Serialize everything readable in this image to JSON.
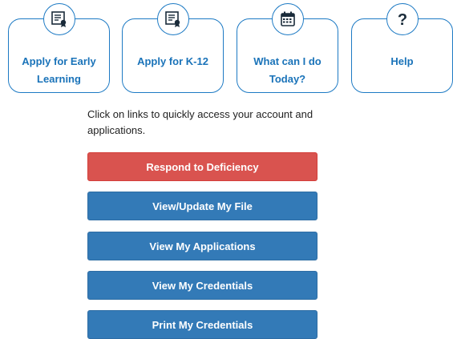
{
  "cards": [
    {
      "label": "Apply for Early Learning",
      "icon": "certificate-icon"
    },
    {
      "label": "Apply for K-12",
      "icon": "certificate-icon"
    },
    {
      "label": "What can I do Today?",
      "icon": "calendar-icon"
    },
    {
      "label": "Help",
      "icon": "question-icon"
    }
  ],
  "intro_text": "Click on links to quickly access your account and applications.",
  "buttons": [
    {
      "label": "Respond to Deficiency",
      "color": "#d9534f"
    },
    {
      "label": "View/Update My File",
      "color": "#337ab7"
    },
    {
      "label": "View My Applications",
      "color": "#337ab7"
    },
    {
      "label": "View My Credentials",
      "color": "#337ab7"
    },
    {
      "label": "Print My Credentials",
      "color": "#337ab7"
    }
  ],
  "colors": {
    "accent": "#1d7ac4",
    "danger": "#d9534f",
    "primary": "#337ab7"
  }
}
